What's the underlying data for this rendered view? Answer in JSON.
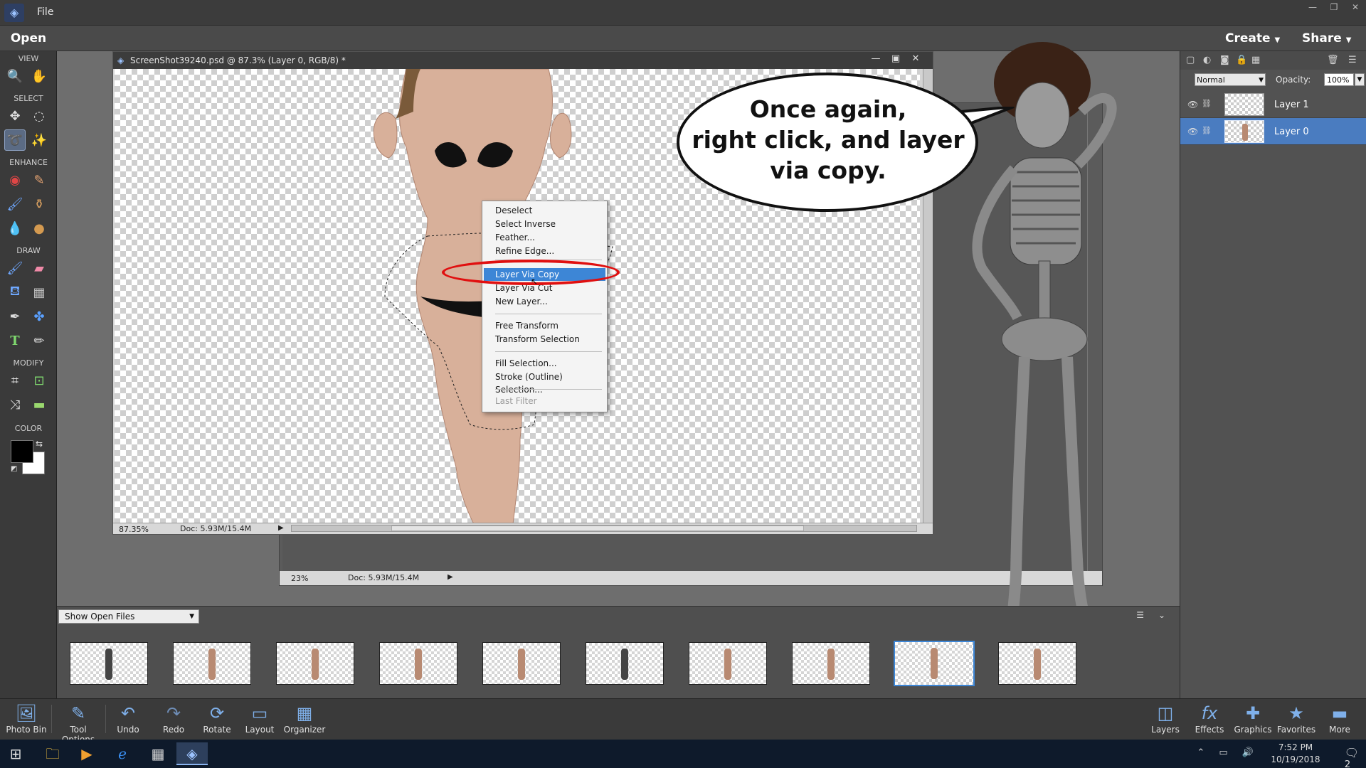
{
  "menubar": {
    "file_label": "File",
    "window_controls": [
      "—",
      "❐",
      "✕"
    ]
  },
  "actionbar": {
    "open_label": "Open",
    "create_label": "Create",
    "share_label": "Share"
  },
  "toolbar": {
    "sections": [
      "VIEW",
      "SELECT",
      "ENHANCE",
      "DRAW",
      "MODIFY",
      "COLOR"
    ],
    "tools": [
      "zoom-icon",
      "hand-icon",
      "move-icon",
      "marquee-icon",
      "lasso-icon",
      "magic-wand-icon",
      "red-eye-icon",
      "spot-healing-icon",
      "smart-brush-icon",
      "clone-stamp-icon",
      "blur-icon",
      "sponge-icon",
      "brush-icon",
      "eraser-icon",
      "paint-bucket-icon",
      "gradient-icon",
      "eyedropper-icon",
      "custom-shape-icon",
      "type-icon",
      "pencil-icon",
      "crop-icon",
      "recompose-icon",
      "content-aware-move-icon",
      "straighten-icon"
    ],
    "foreground_color": "#000000",
    "background_color": "#ffffff"
  },
  "document": {
    "title": "ScreenShot39240.psd @ 87.3% (Layer 0, RGB/8) *",
    "zoom": "87.35%",
    "doc_size": "Doc: 5.93M/15.4M"
  },
  "document2": {
    "zoom": "23%",
    "doc_size": "Doc: 5.93M/15.4M"
  },
  "context_menu": {
    "items": [
      "Deselect",
      "Select Inverse",
      "Feather...",
      "Refine Edge...",
      "Layer Via Copy",
      "Layer Via Cut",
      "New Layer...",
      "Free Transform",
      "Transform Selection",
      "Fill Selection...",
      "Stroke (Outline) Selection...",
      "Last Filter"
    ],
    "highlighted": "Layer Via Copy",
    "highlight_color": "#3d86d6",
    "annotation_ring_color": "#e01010"
  },
  "speech_bubble": {
    "line1": "Once again,",
    "line2": "right click, and layer",
    "line3": "via copy."
  },
  "layers_panel": {
    "blend_mode": "Normal",
    "opacity_label": "Opacity:",
    "opacity_value": "100%",
    "layers": [
      {
        "name": "Layer 1",
        "selected": false
      },
      {
        "name": "Layer 0",
        "selected": true
      }
    ],
    "selected_color": "#4a7cc0"
  },
  "photo_bin": {
    "source_select": "Show Open Files",
    "thumbnail_count": 10,
    "selected_index": 8
  },
  "bottom_bar": {
    "items": [
      "Photo Bin",
      "Tool Options",
      "Undo",
      "Redo",
      "Rotate",
      "Layout",
      "Organizer"
    ],
    "right_items": [
      "Layers",
      "Effects",
      "Graphics",
      "Favorites",
      "More"
    ]
  },
  "taskbar": {
    "time": "7:52 PM",
    "date": "10/19/2018",
    "notification_count": "2"
  }
}
